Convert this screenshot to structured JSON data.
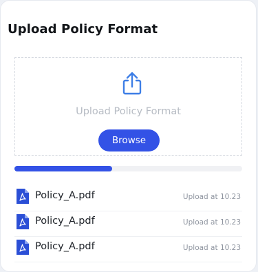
{
  "panel": {
    "title": "Upload Policy Format"
  },
  "dropzone": {
    "icon": "share-upload-icon",
    "label": "Upload Policy Format",
    "browse_label": "Browse"
  },
  "progress": {
    "value": 0.43
  },
  "files": [
    {
      "name": "Policy_A.pdf",
      "meta": "Upload at 10.23",
      "icon": "pdf-file-icon"
    },
    {
      "name": "Policy_A.pdf",
      "meta": "Upload at 10.23",
      "icon": "pdf-file-icon"
    },
    {
      "name": "Policy_A.pdf",
      "meta": "Upload at 10.23",
      "icon": "pdf-file-icon"
    }
  ],
  "colors": {
    "accent": "#3352e6",
    "file_icon": "#2b4fd6"
  }
}
